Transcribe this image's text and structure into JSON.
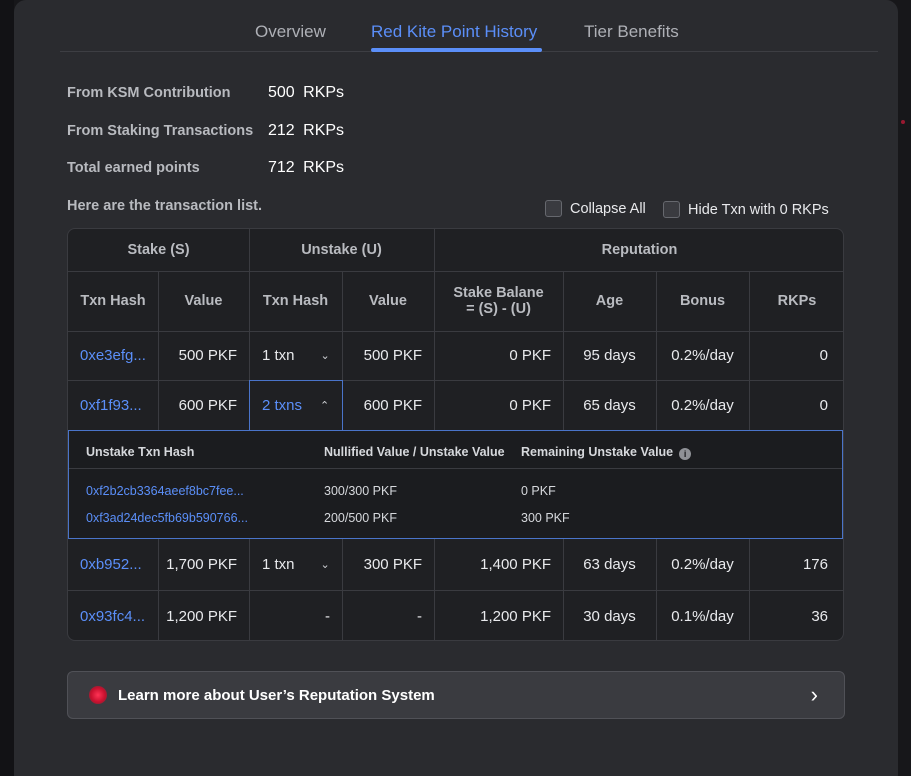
{
  "tabs": [
    {
      "label": "Overview"
    },
    {
      "label": "Red Kite Point History"
    },
    {
      "label": "Tier Benefits"
    }
  ],
  "active_tab": "Red Kite Point History",
  "summary": {
    "ksm_label": "From KSM Contribution",
    "ksm_value": "500 RKPs",
    "staking_label": "From Staking Transactions",
    "staking_value": "212 RKPs",
    "total_label": "Total earned points",
    "total_value": "712 RKPs"
  },
  "list_intro": "Here are the transaction list.",
  "options": {
    "collapse_all": "Collapse All",
    "hide_zero": "Hide Txn with 0 RKPs"
  },
  "table": {
    "groups": {
      "stake": "Stake (S)",
      "unstake": "Unstake (U)",
      "reputation": "Reputation"
    },
    "columns": {
      "stake_hash": "Txn Hash",
      "stake_value": "Value",
      "unstake_hash": "Txn Hash",
      "unstake_value": "Value",
      "balance_line1": "Stake Balane",
      "balance_line2": "= (S) - (U)",
      "age": "Age",
      "bonus": "Bonus",
      "rkps": "RKPs"
    },
    "rows": [
      {
        "stake_hash": "0xe3efg...",
        "stake_value": "500 PKF",
        "unstake_hash": "1 txn",
        "unstake_value": "500 PKF",
        "balance": "0 PKF",
        "age": "95 days",
        "bonus": "0.2%/day",
        "rkps": "0",
        "expanded": false
      },
      {
        "stake_hash": "0xf1f93...",
        "stake_value": "600 PKF",
        "unstake_hash": "2 txns",
        "unstake_value": "600 PKF",
        "balance": "0 PKF",
        "age": "65 days",
        "bonus": "0.2%/day",
        "rkps": "0",
        "expanded": true
      },
      {
        "stake_hash": "0xb952...",
        "stake_value": "1,700 PKF",
        "unstake_hash": "1 txn",
        "unstake_value": "300 PKF",
        "balance": "1,400 PKF",
        "age": "63 days",
        "bonus": "0.2%/day",
        "rkps": "176",
        "expanded": false
      },
      {
        "stake_hash": "0x93fc4...",
        "stake_value": "1,200 PKF",
        "unstake_hash": "-",
        "unstake_value": "-",
        "balance": "1,200 PKF",
        "age": "30 days",
        "bonus": "0.1%/day",
        "rkps": "36",
        "expanded": false
      }
    ],
    "subtable": {
      "headers": {
        "hash": "Unstake Txn Hash",
        "nullified": "Nullified Value / Unstake Value",
        "remaining": "Remaining Unstake Value"
      },
      "rows": [
        {
          "hash": "0xf2b2cb3364aeef8bc7fee...",
          "nullified": "300/300 PKF",
          "remaining": "0 PKF"
        },
        {
          "hash": "0xf3ad24dec5fb69b590766...",
          "nullified": "200/500 PKF",
          "remaining": "300 PKF"
        }
      ]
    }
  },
  "learn_more": "Learn more about User’s Reputation System",
  "colors": {
    "accent": "#5b8ff9",
    "card_bg": "#2a2b2f",
    "page_bg": "#17171a",
    "brand_red": "#c8102e"
  }
}
